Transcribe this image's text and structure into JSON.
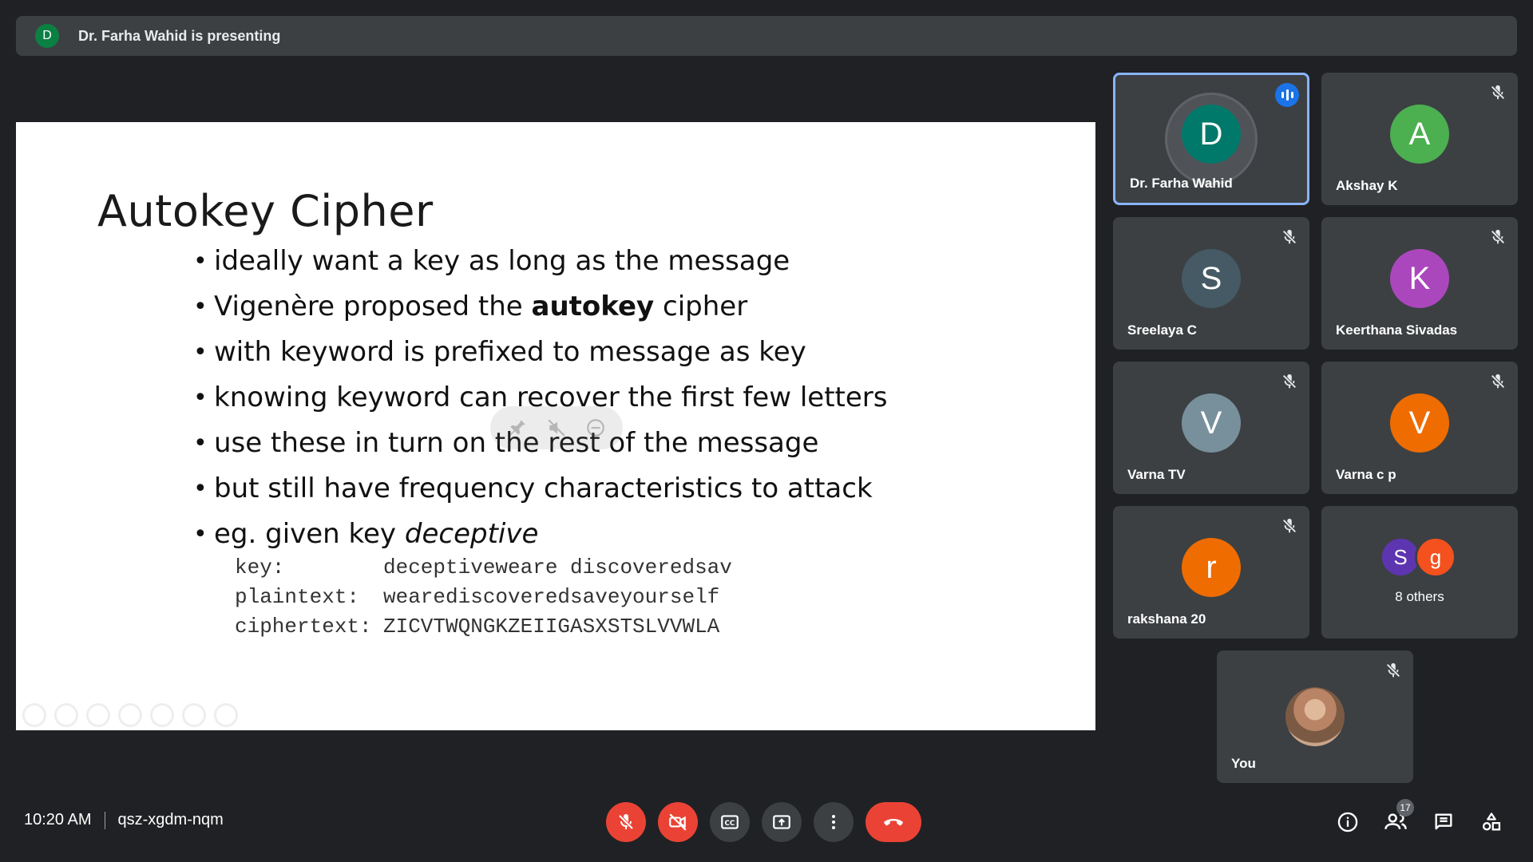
{
  "banner": {
    "avatar_letter": "D",
    "text": "Dr. Farha Wahid is presenting"
  },
  "slide": {
    "title": "Autokey Cipher",
    "bullets": [
      {
        "plain": "ideally want a key as long as the message"
      },
      {
        "before": "Vigenère proposed the ",
        "bold": "autokey",
        "after": " cipher"
      },
      {
        "plain": "with keyword is prefixed to message as key"
      },
      {
        "plain": "knowing keyword can recover the first few letters"
      },
      {
        "plain": "use these in turn on the rest of the message"
      },
      {
        "plain": "but still have frequency characteristics to attack"
      },
      {
        "before": "eg. given key ",
        "italic": "deceptive"
      }
    ],
    "code": [
      {
        "label": "key:",
        "value": "deceptiveweare discoveredsav"
      },
      {
        "label": "plaintext:",
        "value": "wearediscoveredsaveyourself"
      },
      {
        "label": "ciphertext:",
        "value": "ZICVTWQNGKZEIIGASXSTSLVVWLA"
      }
    ]
  },
  "participants": [
    {
      "name": "Dr. Farha Wahid",
      "letter": "D",
      "color": "#00796b",
      "speaking": true
    },
    {
      "name": "Akshay K",
      "letter": "A",
      "color": "#4caf50",
      "muted": true
    },
    {
      "name": "Sreelaya C",
      "letter": "S",
      "color": "#455a64",
      "muted": true
    },
    {
      "name": "Keerthana Sivadas",
      "letter": "K",
      "color": "#ab47bc",
      "muted": true
    },
    {
      "name": "Varna TV",
      "letter": "V",
      "color": "#78909c",
      "muted": true
    },
    {
      "name": "Varna c p",
      "letter": "V",
      "color": "#ef6c00",
      "muted": true
    },
    {
      "name": "rakshana 20",
      "letter": "r",
      "color": "#ef6c00",
      "muted": true
    }
  ],
  "others_tile": {
    "letters": [
      "S",
      "g"
    ],
    "colors": [
      "#5e35b1",
      "#f4511e"
    ],
    "label": "8 others"
  },
  "self_tile": {
    "name": "You",
    "muted": true
  },
  "bottom": {
    "time": "10:20 AM",
    "meeting_code": "qsz-xgdm-nqm",
    "people_count": "17"
  },
  "colors": {
    "background": "#202124",
    "tile": "#3c4043",
    "danger": "#ea4335",
    "active_border": "#8ab4f8",
    "speaking": "#1a73e8"
  },
  "icons": {
    "mic": "mic-off-icon",
    "camera": "camera-off-icon",
    "captions": "captions-icon",
    "present": "present-icon",
    "more": "more-vert-icon",
    "leave": "end-call-icon",
    "info": "info-icon",
    "people": "people-icon",
    "chat": "chat-icon",
    "activities": "activities-icon"
  }
}
